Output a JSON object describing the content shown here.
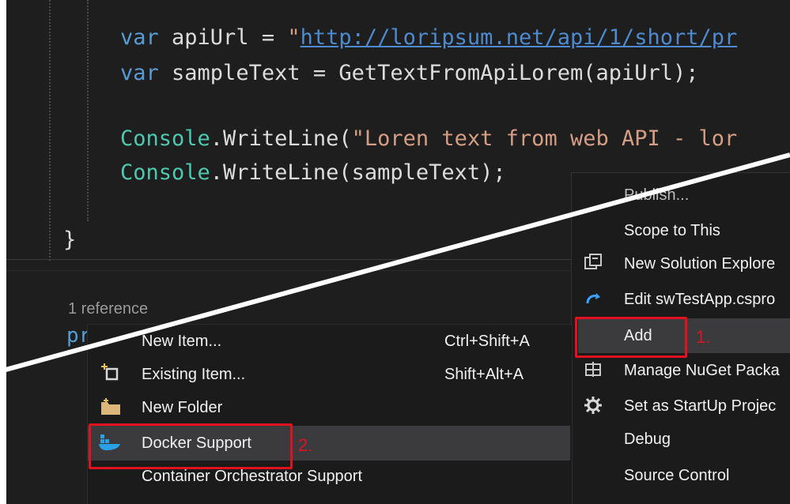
{
  "editor": {
    "line1": {
      "kw": "var",
      "name": " apiUrl = ",
      "str_q": "\"",
      "url": "http://loripsum.net/api/1/short/pr"
    },
    "line2": {
      "kw": "var",
      "rest": " sampleText = GetTextFromApiLorem(apiUrl);"
    },
    "line3": {
      "type": "Console",
      "dot": ".WriteLine(",
      "str": "\"Loren text from web API - lor"
    },
    "line4": {
      "type": "Console",
      "rest": ".WriteLine(sampleText);"
    },
    "brace": "}",
    "codelens": "1 reference",
    "next_line_kw": "priva"
  },
  "context_menu_right": {
    "items": [
      {
        "label": "Publish..."
      },
      {
        "label": "Scope to This"
      },
      {
        "label": "New Solution Explore"
      },
      {
        "label": "Edit swTestApp.cspro"
      },
      {
        "label": "Add"
      },
      {
        "label": "Manage NuGet Packa"
      },
      {
        "label": "Set as StartUp Projec"
      },
      {
        "label": "Debug"
      },
      {
        "label": "Source Control"
      }
    ],
    "step_label": "1."
  },
  "add_submenu": {
    "items": [
      {
        "label": "New Item...",
        "shortcut": "Ctrl+Shift+A"
      },
      {
        "label": "Existing Item...",
        "shortcut": "Shift+Alt+A"
      },
      {
        "label": "New Folder",
        "shortcut": ""
      },
      {
        "label": "Docker Support",
        "shortcut": ""
      },
      {
        "label": "Container Orchestrator Support",
        "shortcut": ""
      }
    ],
    "step_label": "2."
  },
  "colors": {
    "highlight_red": "#e0121f",
    "keyword": "#569cd6",
    "type": "#4ec9b0",
    "string": "#d69d85"
  }
}
